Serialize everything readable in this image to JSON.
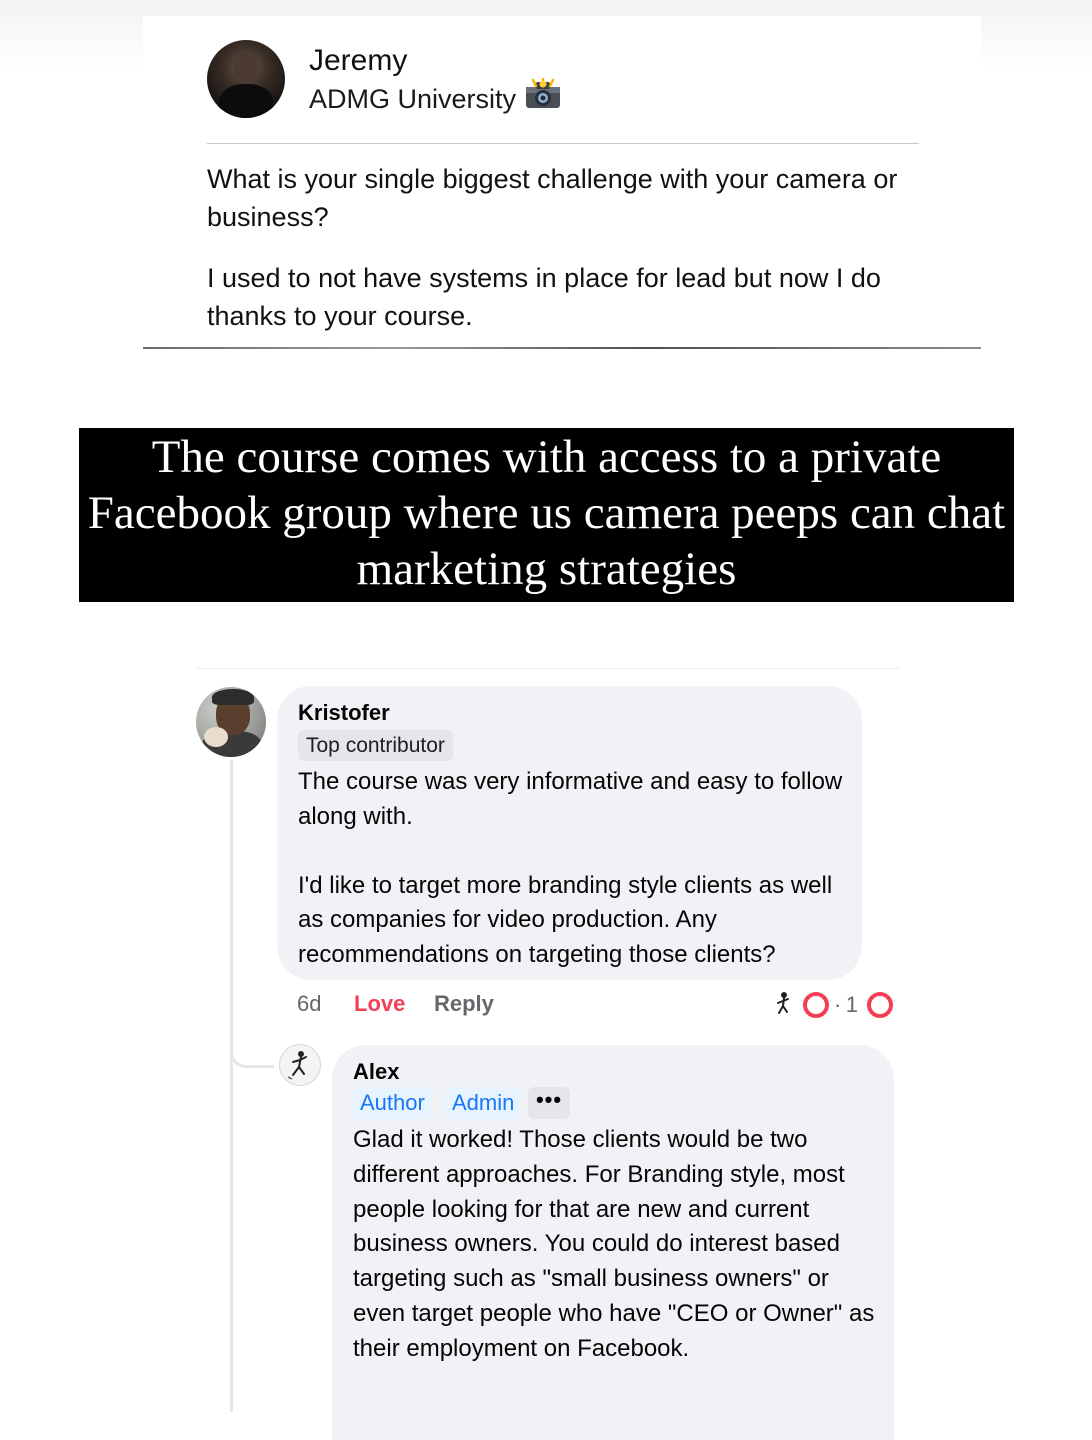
{
  "post": {
    "author": "Jeremy",
    "group": "ADMG University",
    "group_icon": "camera-icon",
    "question": "What is your single biggest challenge with your camera or business?",
    "answer": "I used to not have systems in place for lead but now I do thanks to your course."
  },
  "caption": {
    "text": "The course comes with access to a private Facebook group where us camera peeps can chat marketing strategies",
    "background": "#000000",
    "color": "#ffffff"
  },
  "comment": {
    "author": "Kristofer",
    "badge": "Top contributor",
    "paragraphs": [
      "The course was very informative and easy to follow along with.",
      "I'd like to target more branding style clients as well as companies for video production. Any recommendations on targeting those clients?"
    ],
    "time": "6d",
    "love_label": "Love",
    "reply_label": "Reply",
    "reaction_separator": "·",
    "reaction_count": "1",
    "reaction_icon": "heart-icon"
  },
  "reply": {
    "author": "Alex",
    "badges": [
      "Author",
      "Admin"
    ],
    "more_label": "•••",
    "text": "Glad it worked! Those clients would be two different approaches. For Branding style, most people looking for that are new and current business owners. You could do interest based targeting such as \"small business owners\" or even target people who have \"CEO or Owner\" as their employment on Facebook."
  },
  "colors": {
    "bubble": "#f0f2f5",
    "love": "#f33e58",
    "admin_badge_text": "#1877f2",
    "admin_badge_bg": "#e7f3ff",
    "muted_text": "#65676b"
  }
}
